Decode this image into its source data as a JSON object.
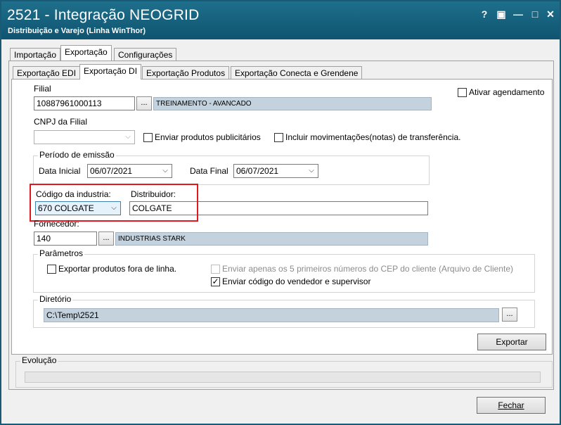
{
  "window": {
    "title": "2521 - Integração NEOGRID",
    "subtitle": "Distribuição e Varejo (Linha WinThor)",
    "help": "?",
    "restore": "▣",
    "minimize": "—",
    "maximize": "□",
    "close": "✕"
  },
  "main_tabs": [
    "Importação",
    "Exportação",
    "Configurações"
  ],
  "sub_tabs": [
    "Exportação EDI",
    "Exportação DI",
    "Exportação Produtos",
    "Exportação Conecta e Grendene"
  ],
  "form": {
    "filial_label": "Filial",
    "filial_value": "10887961000113",
    "filial_name": "TREINAMENTO - AVANCADO",
    "ellipsis": "...",
    "ativar_agendamento": "Ativar agendamento",
    "cnpj_label": "CNPJ da Filial",
    "cnpj_value": "",
    "enviar_publicitarios": "Enviar produtos publicitários",
    "incluir_movimentacoes": "Incluir movimentações(notas) de transferência.",
    "periodo_label": "Período de emissão",
    "data_inicial_label": "Data Inicial",
    "data_inicial_value": "06/07/2021",
    "data_final_label": "Data Final",
    "data_final_value": "06/07/2021",
    "codigo_industria_label": "Código da industria:",
    "codigo_industria_value": "670 COLGATE",
    "distribuidor_label": "Distribuidor:",
    "distribuidor_value": "COLGATE",
    "fornecedor_label": "Fornecedor:",
    "fornecedor_value": "140",
    "fornecedor_name": "INDUSTRIAS STARK",
    "parametros_label": "Parâmetros",
    "exportar_fora_linha": "Exportar produtos fora de linha.",
    "enviar_cep": "Enviar apenas os 5 primeiros números do CEP do cliente (Arquivo de Cliente)",
    "enviar_vendedor": "Enviar código do vendedor e supervisor",
    "check_mark": "✓",
    "diretorio_label": "Diretório",
    "diretorio_value": "C:\\Temp\\2521",
    "exportar_button": "Exportar"
  },
  "evolucao_label": "Evolução",
  "progress": 0,
  "fechar_button": "Fechar",
  "dropdown_glyph": "⌵",
  "colors": {
    "title_bg": "#0f5470",
    "highlight": "#e0191f",
    "readonly_bg": "#c4d2de"
  }
}
